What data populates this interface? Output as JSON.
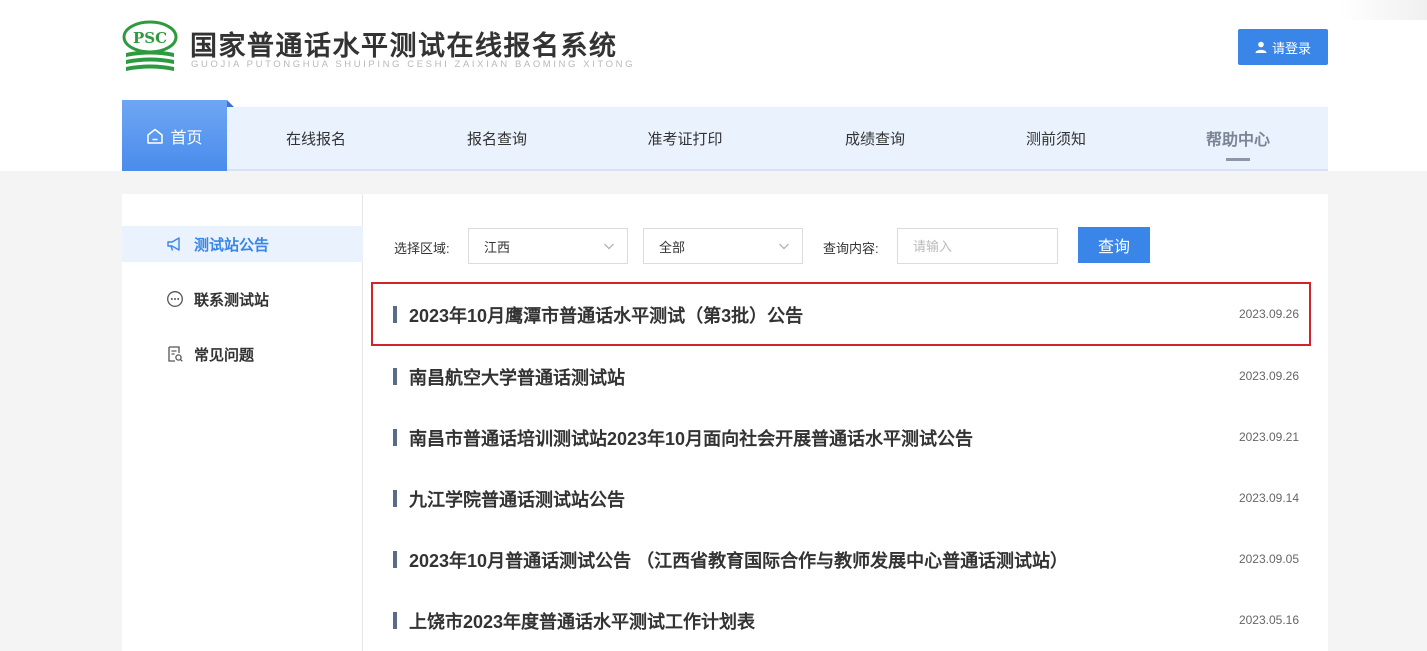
{
  "header": {
    "logo_mark_text": "PSC",
    "title": "国家普通话水平测试在线报名系统",
    "subtitle": "GUOJIA PUTONGHUA SHUIPING CESHI ZAIXIAN BAOMING XITONG",
    "login_label": "请登录"
  },
  "nav": {
    "items": [
      {
        "label": "首页"
      },
      {
        "label": "在线报名"
      },
      {
        "label": "报名查询"
      },
      {
        "label": "准考证打印"
      },
      {
        "label": "成绩查询"
      },
      {
        "label": "测前须知"
      },
      {
        "label": "帮助中心"
      }
    ]
  },
  "sidebar": {
    "items": [
      {
        "label": "测试站公告",
        "icon": "megaphone-icon"
      },
      {
        "label": "联系测试站",
        "icon": "chat-bubble-icon"
      },
      {
        "label": "常见问题",
        "icon": "document-search-icon"
      }
    ]
  },
  "filter": {
    "region_label": "选择区域:",
    "region_value": "江西",
    "scope_value": "全部",
    "query_label": "查询内容:",
    "query_placeholder": "请输入",
    "search_label": "查询"
  },
  "announcements": [
    {
      "title": "2023年10月鹰潭市普通话水平测试（第3批）公告",
      "date": "2023.09.26"
    },
    {
      "title": "南昌航空大学普通话测试站",
      "date": "2023.09.26"
    },
    {
      "title": "南昌市普通话培训测试站2023年10月面向社会开展普通话水平测试公告",
      "date": "2023.09.21"
    },
    {
      "title": "九江学院普通话测试站公告",
      "date": "2023.09.14"
    },
    {
      "title": "2023年10月普通话测试公告 （江西省教育国际合作与教师发展中心普通话测试站）",
      "date": "2023.09.05"
    },
    {
      "title": "上饶市2023年度普通话水平测试工作计划表",
      "date": "2023.05.16"
    }
  ],
  "colors": {
    "primary": "#3a86e8",
    "nav_bg": "#eaf2fd",
    "highlight_border": "#d2232a",
    "logo_green": "#2e9a3f"
  }
}
